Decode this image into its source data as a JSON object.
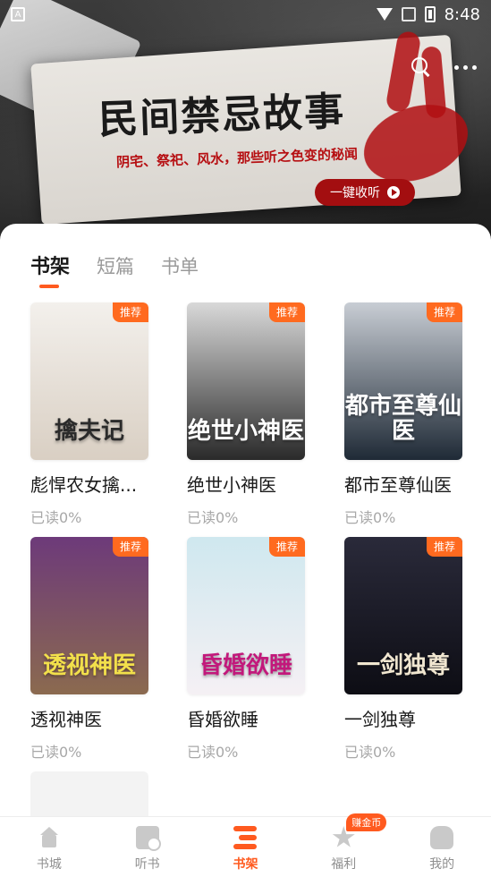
{
  "status_bar": {
    "time": "8:48",
    "indicator": "A"
  },
  "banner": {
    "title": "民间禁忌故事",
    "subtitle": "阴宅、祭祀、风水，那些听之色变的秘闻",
    "button_label": "一键收听"
  },
  "tabs": [
    {
      "label": "书架",
      "active": true
    },
    {
      "label": "短篇",
      "active": false
    },
    {
      "label": "书单",
      "active": false
    }
  ],
  "books": [
    {
      "title": "彪悍农女擒...",
      "progress": "已读0%",
      "tag": "推荐",
      "cover_text": "擒夫记",
      "cover_colors": [
        "#f3f0ec",
        "#d9cfc3"
      ],
      "cover_text_color": "#2b2b2b"
    },
    {
      "title": "绝世小神医",
      "progress": "已读0%",
      "tag": "推荐",
      "cover_text": "绝世小神医",
      "cover_colors": [
        "#d9d9d9",
        "#2a2a2a"
      ],
      "cover_text_color": "#ffffff"
    },
    {
      "title": "都市至尊仙医",
      "progress": "已读0%",
      "tag": "推荐",
      "cover_text": "都市至尊仙医",
      "cover_colors": [
        "#c8cdd4",
        "#1f2a36"
      ],
      "cover_text_color": "#ffffff"
    },
    {
      "title": "透视神医",
      "progress": "已读0%",
      "tag": "推荐",
      "cover_text": "透视神医",
      "cover_colors": [
        "#6d3a7a",
        "#8b6a4f"
      ],
      "cover_text_color": "#f2e04b"
    },
    {
      "title": "昏婚欲睡",
      "progress": "已读0%",
      "tag": "推荐",
      "cover_text": "昏婚欲睡",
      "cover_colors": [
        "#cfe8ef",
        "#f5f0f4"
      ],
      "cover_text_color": "#c2187b"
    },
    {
      "title": "一剑独尊",
      "progress": "已读0%",
      "tag": "推荐",
      "cover_text": "一剑独尊",
      "cover_colors": [
        "#2a2a3a",
        "#0d0d14"
      ],
      "cover_text_color": "#f0e6d0"
    }
  ],
  "bottom_nav": [
    {
      "label": "书城",
      "icon": "home-icon",
      "active": false
    },
    {
      "label": "听书",
      "icon": "listen-icon",
      "active": false
    },
    {
      "label": "书架",
      "icon": "shelf-icon",
      "active": true
    },
    {
      "label": "福利",
      "icon": "welfare-icon",
      "active": false,
      "badge": "赚金币"
    },
    {
      "label": "我的",
      "icon": "mine-icon",
      "active": false
    }
  ],
  "colors": {
    "accent": "#ff5a1f",
    "tag": "#ff6a1f",
    "banner_red": "#a30e10"
  }
}
